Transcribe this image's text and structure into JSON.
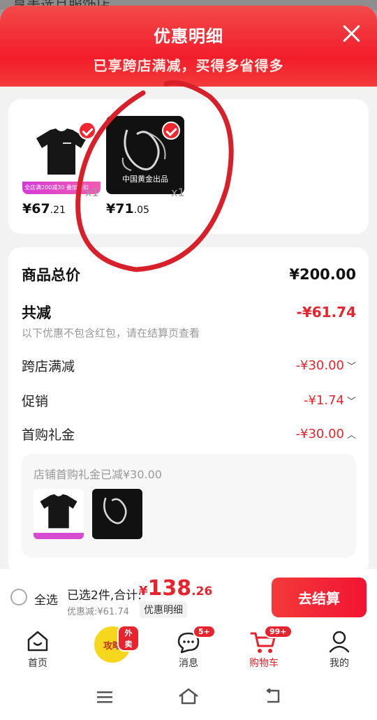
{
  "background": {
    "partial_title": "享美选旦服饰店"
  },
  "header": {
    "title": "优惠明细",
    "subtitle": "已享跨店满减，买得多省得多",
    "bg_color": "#f21d2a"
  },
  "products": [
    {
      "promo_tag": "全店满200减30 叠加折扣",
      "price_int": "¥67",
      "price_dec": ".21",
      "qty": "x1",
      "selected": true
    },
    {
      "image_text": "中国黄金出品",
      "price_int": "¥71",
      "price_dec": ".05",
      "qty": "x1",
      "selected": true
    }
  ],
  "summary": {
    "goods_total_label": "商品总价",
    "goods_total_value": "¥200.00",
    "total_discount_label": "共减",
    "total_discount_value": "-¥61.74",
    "note": "以下优惠不包含红包，请在结算页查看",
    "items": [
      {
        "label": "跨店满减",
        "value": "-¥30.00",
        "chevron": "down"
      },
      {
        "label": "促销",
        "value": "-¥1.74",
        "chevron": "down"
      },
      {
        "label": "首购礼金",
        "value": "-¥30.00",
        "chevron": "up"
      }
    ],
    "sub_box_title": "店铺首购礼金已减¥30.00"
  },
  "bottom_bar": {
    "select_all": "全选",
    "selected_text": "已选2件,合计:",
    "total_symbol": "¥",
    "total_int": "138",
    "total_dec": ".26",
    "saved_text": "优惠减:¥61.74",
    "detail_tag": "优惠明细",
    "checkout": "去结算"
  },
  "tabbar": {
    "items": [
      {
        "label": "首页",
        "icon": "home-icon"
      },
      {
        "label": "攻略",
        "icon": "guide-icon",
        "badge": "外卖"
      },
      {
        "label": "消息",
        "icon": "message-icon",
        "badge": "5+"
      },
      {
        "label": "购物车",
        "icon": "cart-icon",
        "badge": "99+",
        "active": true
      },
      {
        "label": "我的",
        "icon": "profile-icon"
      }
    ]
  },
  "colors": {
    "accent": "#e7242d",
    "annotation": "#d8202a"
  }
}
